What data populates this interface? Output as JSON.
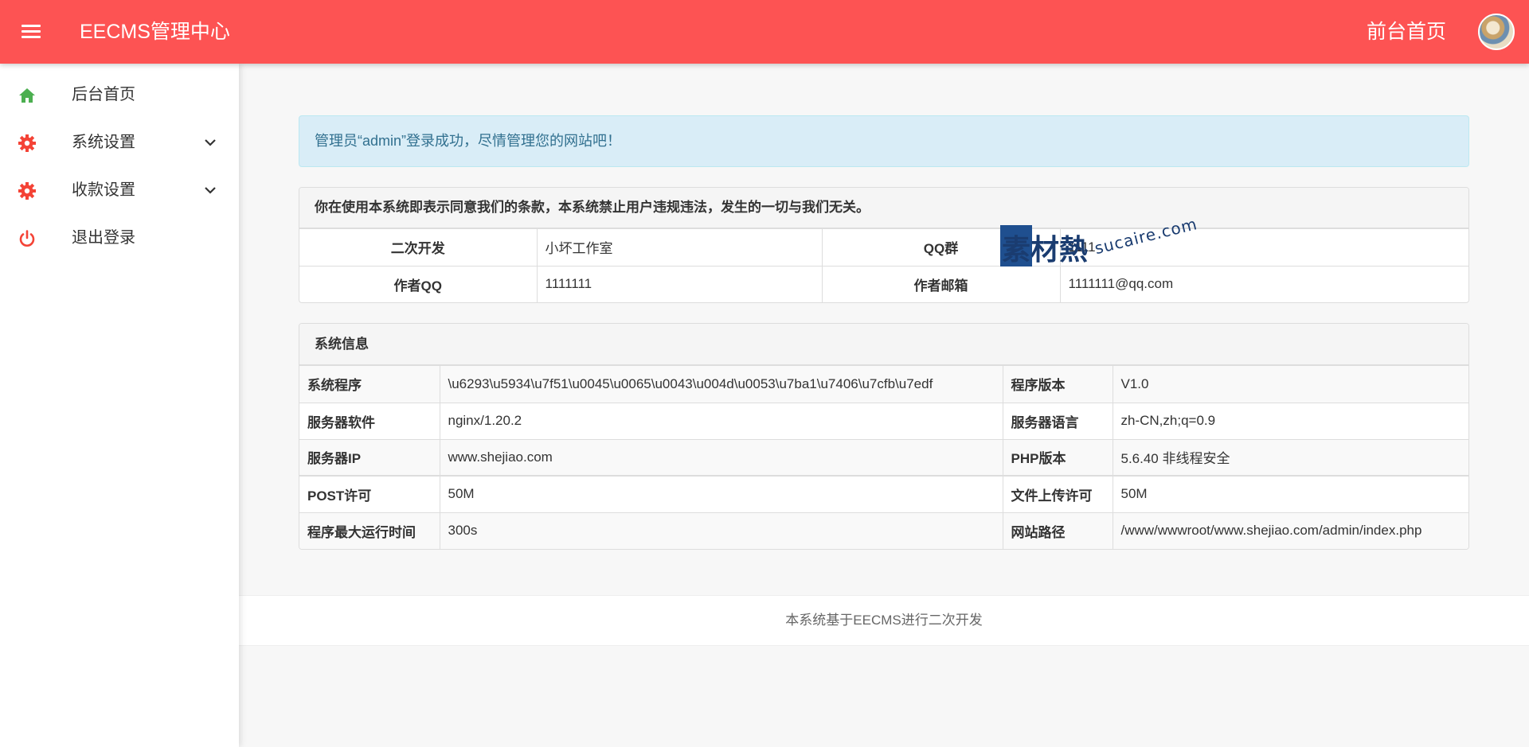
{
  "header": {
    "brand": "EECMS管理中心",
    "front_link": "前台首页"
  },
  "sidebar": {
    "items": [
      {
        "label": "后台首页",
        "icon": "home-icon"
      },
      {
        "label": "系统设置",
        "icon": "gear-icon"
      },
      {
        "label": "收款设置",
        "icon": "gear-icon"
      },
      {
        "label": "退出登录",
        "icon": "power-icon"
      }
    ]
  },
  "alert": {
    "text": "管理员“admin”登录成功，尽情管理您的网站吧！"
  },
  "info_panel": {
    "title": "你在使用本系统即表示同意我们的条款，本系统禁止用户违规违法，发生的一切与我们无关。",
    "rows": [
      {
        "k1": "二次开发",
        "v1": "小坏工作室",
        "k2": "QQ群",
        "v2": "1111"
      },
      {
        "k1": "作者QQ",
        "v1": "1111111",
        "k2": "作者邮箱",
        "v2": "1111111@qq.com"
      }
    ]
  },
  "system_panel": {
    "title": "系统信息",
    "rows": [
      {
        "k1": "系统程序",
        "v1": "\\u6293\\u5934\\u7f51\\u0045\\u0065\\u0043\\u004d\\u0053\\u7ba1\\u7406\\u7cfb\\u7edf",
        "k2": "程序版本",
        "v2": "V1.0"
      },
      {
        "k1": "服务器软件",
        "v1": "nginx/1.20.2",
        "k2": "服务器语言",
        "v2": "zh-CN,zh;q=0.9"
      },
      {
        "k1": "服务器IP",
        "v1": "www.shejiao.com",
        "k2": "PHP版本",
        "v2": "5.6.40 非线程安全"
      },
      {
        "k1": "POST许可",
        "v1": "50M",
        "k2": "文件上传许可",
        "v2": "50M"
      },
      {
        "k1": "程序最大运行时间",
        "v1": "300s",
        "k2": "网站路径",
        "v2": "/www/wwwroot/www.shejiao.com/admin/index.php"
      }
    ]
  },
  "footer": {
    "text": "本系统基于EECMS进行二次开发"
  },
  "watermark": {
    "cn": "素材熱",
    "en": "sucaire.com"
  },
  "colors": {
    "header": "#fd5353",
    "home_icon": "#4caf50",
    "gear_icon": "#f44336",
    "alert_bg": "#d9edf7",
    "alert_text": "#31708f"
  }
}
